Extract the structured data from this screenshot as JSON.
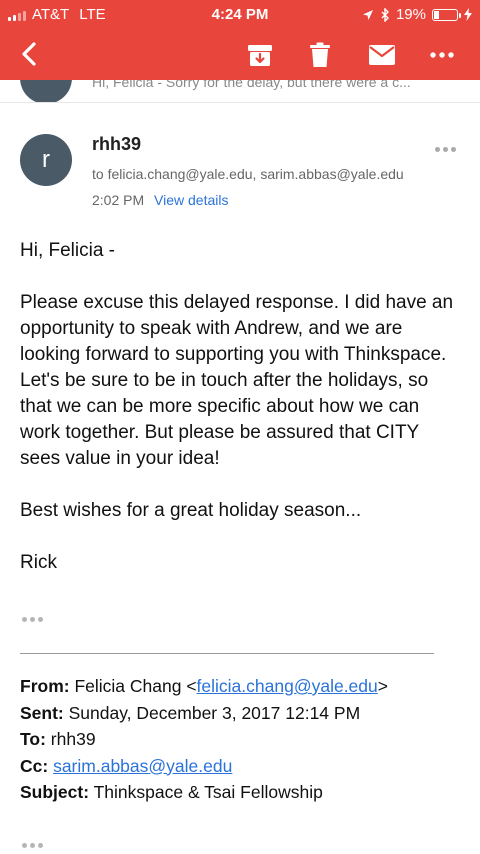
{
  "status": {
    "carrier": "AT&T",
    "network": "LTE",
    "time": "4:24 PM",
    "battery": "19%",
    "battery_level": 0.19
  },
  "toolbar": {
    "back_icon": "back-arrow-icon",
    "archive_icon": "archive-icon",
    "delete_icon": "trash-icon",
    "mark_unread_icon": "mail-icon",
    "more_icon": "more-horizontal-icon"
  },
  "previous_message": {
    "snippet": "Hi, Felicia - Sorry for the delay, but there were a c..."
  },
  "message": {
    "avatar_letter": "r",
    "sender": "rhh39",
    "recipients": "to felicia.chang@yale.edu, sarim.abbas@yale.edu",
    "time": "2:02 PM",
    "view_details": "View details",
    "greeting": "Hi, Felicia -",
    "paragraph": "Please excuse this delayed response.  I did have an opportunity to speak with Andrew, and we are looking forward to supporting you with Thinkspace.  Let's be sure to be in touch after the holidays, so that we can be more specific about how we can work together.  But please be assured that CITY sees value in your idea!",
    "closing": "Best wishes for a great holiday season...",
    "signature": "Rick"
  },
  "quoted": {
    "from_label": "From:",
    "from_name": "Felicia Chang",
    "from_email": "felicia.chang@yale.edu",
    "sent_label": "Sent:",
    "sent_value": "Sunday, December 3, 2017 12:14 PM",
    "to_label": "To:",
    "to_value": "rhh39",
    "cc_label": "Cc:",
    "cc_value": "sarim.abbas@yale.edu",
    "subject_label": "Subject:",
    "subject_value": "Thinkspace & Tsai Fellowship"
  },
  "colors": {
    "toolbar_red": "#e8453c",
    "link_blue": "#2a73d9",
    "avatar_gray": "#4a5a66"
  }
}
